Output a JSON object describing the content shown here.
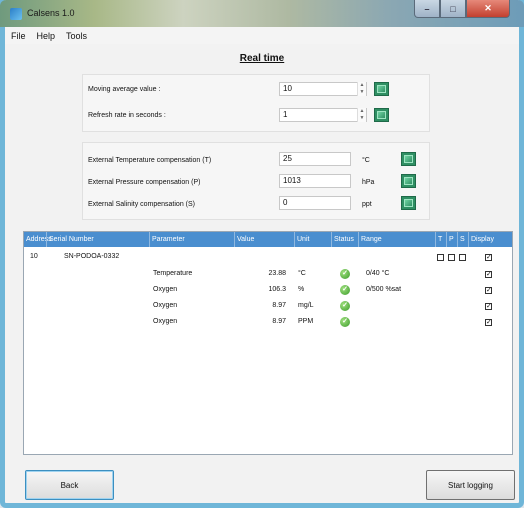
{
  "window": {
    "title": "Calsens 1.0"
  },
  "menu": {
    "items": [
      "File",
      "Help",
      "Tools"
    ]
  },
  "page": {
    "heading": "Real time"
  },
  "settings": {
    "moving_average": {
      "label": "Moving average value :",
      "value": "10"
    },
    "refresh_rate": {
      "label": "Refresh rate in seconds :",
      "value": "1"
    }
  },
  "compensation": {
    "temperature": {
      "label": "External Temperature compensation (T)",
      "value": "25",
      "unit": "°C"
    },
    "pressure": {
      "label": "External Pressure compensation (P)",
      "value": "1013",
      "unit": "hPa"
    },
    "salinity": {
      "label": "External Salinity compensation (S)",
      "value": "0",
      "unit": "ppt"
    }
  },
  "table": {
    "columns": [
      "Address",
      "Serial Number",
      "Parameter",
      "Value",
      "Unit",
      "Status",
      "Range",
      "T",
      "P",
      "S",
      "Display"
    ],
    "device": {
      "address": "10",
      "serial": "SN-PODOA-0332"
    },
    "rows": [
      {
        "parameter": "Temperature",
        "value": "23.88",
        "unit": "°C",
        "range": "0/40 °C"
      },
      {
        "parameter": "Oxygen",
        "value": "106.3",
        "unit": "%",
        "range": "0/500 %sat"
      },
      {
        "parameter": "Oxygen",
        "value": "8.97",
        "unit": "mg/L",
        "range": ""
      },
      {
        "parameter": "Oxygen",
        "value": "8.97",
        "unit": "PPM",
        "range": ""
      }
    ]
  },
  "buttons": {
    "back": "Back",
    "start_logging": "Start logging"
  },
  "colors": {
    "header_blue": "#4a8ecf",
    "status_ok": "#3a9a2a",
    "apply_green": "#2f8f63"
  }
}
